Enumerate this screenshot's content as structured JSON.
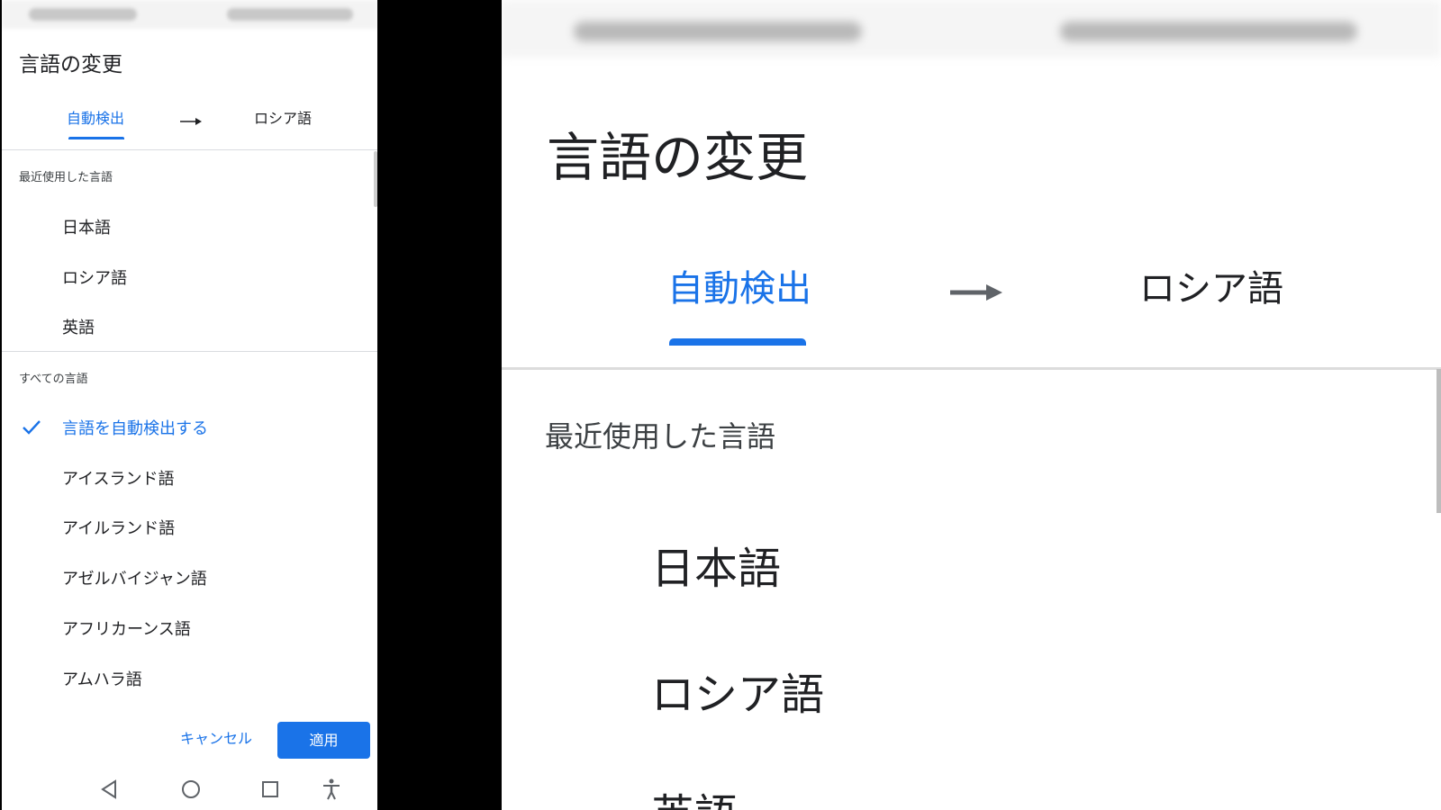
{
  "dialog": {
    "title": "言語の変更",
    "tabs": {
      "source": "自動検出",
      "target": "ロシア語"
    },
    "sections": {
      "recent": {
        "heading": "最近使用した言語",
        "items": [
          "日本語",
          "ロシア語",
          "英語"
        ]
      },
      "all": {
        "heading": "すべての言語",
        "items": [
          {
            "label": "言語を自動検出する",
            "selected": true
          },
          {
            "label": "アイスランド語",
            "selected": false
          },
          {
            "label": "アイルランド語",
            "selected": false
          },
          {
            "label": "アゼルバイジャン語",
            "selected": false
          },
          {
            "label": "アフリカーンス語",
            "selected": false
          },
          {
            "label": "アムハラ語",
            "selected": false
          }
        ]
      }
    },
    "buttons": {
      "cancel": "キャンセル",
      "apply": "適用"
    }
  },
  "navbar": {
    "icons": [
      "back-icon",
      "home-icon",
      "recents-icon",
      "accessibility-icon"
    ]
  },
  "colors": {
    "accent": "#1a73e8",
    "text": "#202124",
    "divider": "#dadce0"
  },
  "zoom": {
    "title": "言語の変更",
    "tabs": {
      "source": "自動検出",
      "target": "ロシア語"
    },
    "section_heading": "最近使用した言語",
    "items": [
      "日本語",
      "ロシア語",
      "英語"
    ]
  }
}
